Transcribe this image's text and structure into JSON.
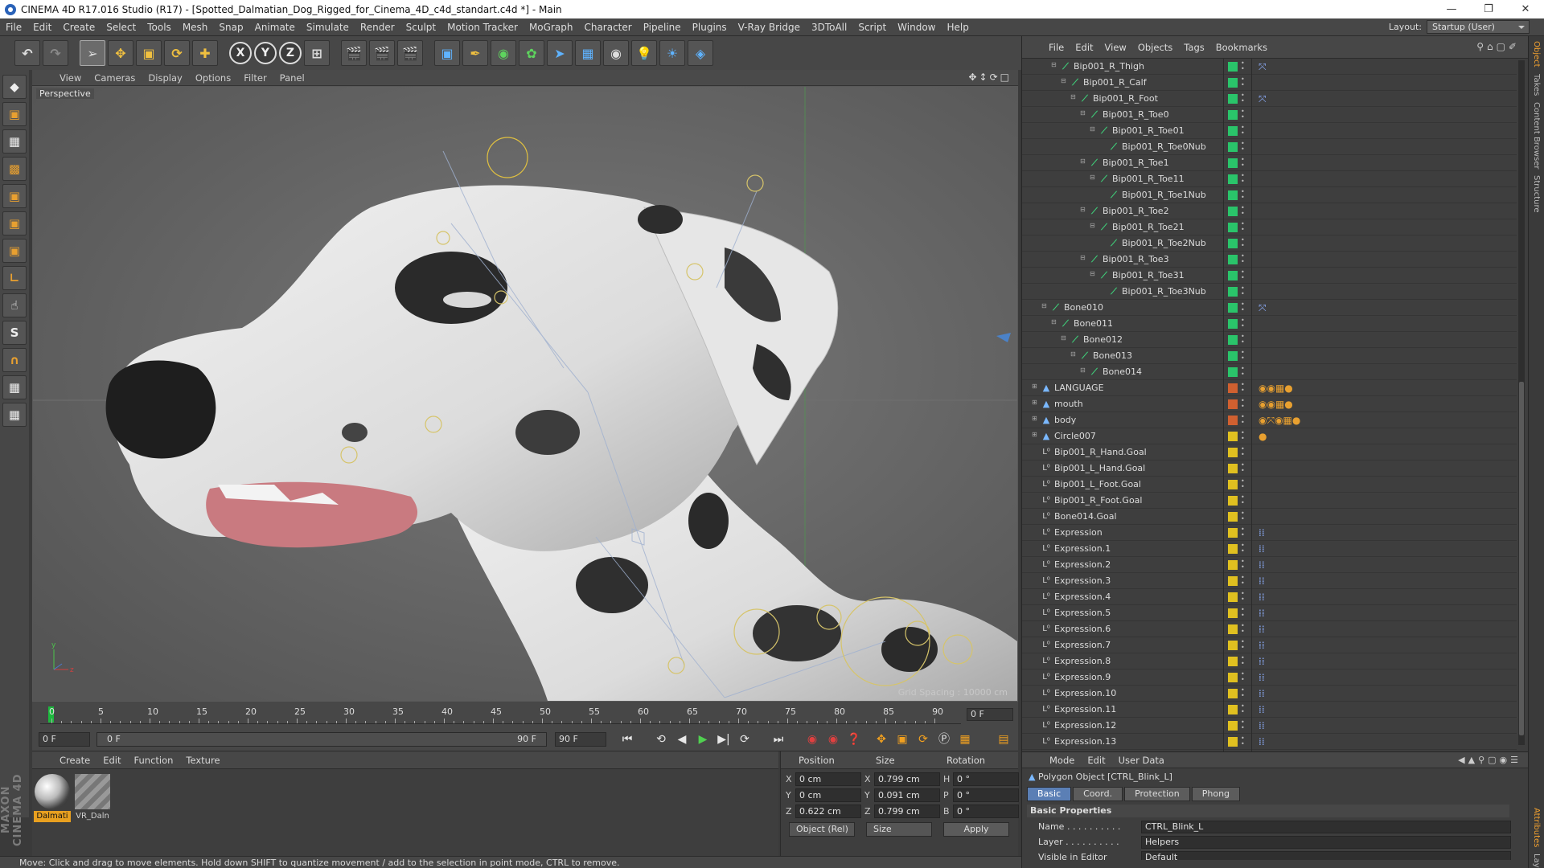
{
  "title": "CINEMA 4D R17.016 Studio (R17) - [Spotted_Dalmatian_Dog_Rigged_for_Cinema_4D_c4d_standart.c4d *] - Main",
  "menu": [
    "File",
    "Edit",
    "Create",
    "Select",
    "Tools",
    "Mesh",
    "Snap",
    "Animate",
    "Simulate",
    "Render",
    "Sculpt",
    "Motion Tracker",
    "MoGraph",
    "Character",
    "Pipeline",
    "Plugins",
    "V-Ray Bridge",
    "3DToAll",
    "Script",
    "Window",
    "Help"
  ],
  "layout": {
    "label": "Layout:",
    "value": "Startup (User)"
  },
  "viewport": {
    "menu": [
      "View",
      "Cameras",
      "Display",
      "Options",
      "Filter",
      "Panel"
    ],
    "camera": "Perspective",
    "grid": "Grid Spacing : 10000 cm"
  },
  "timeline": {
    "ticks": [
      "0",
      "5",
      "10",
      "15",
      "20",
      "25",
      "30",
      "35",
      "40",
      "45",
      "50",
      "55",
      "60",
      "65",
      "70",
      "75",
      "80",
      "85",
      "90"
    ],
    "end": "0 F",
    "start": "0 F",
    "range_start": "0 F",
    "range_end": "90 F",
    "max": "90 F"
  },
  "materials": {
    "menu": [
      "Create",
      "Edit",
      "Function",
      "Texture"
    ],
    "items": [
      "Dalmati",
      "VR_Daln"
    ]
  },
  "coords": {
    "headers": [
      "Position",
      "Size",
      "Rotation"
    ],
    "rows": [
      {
        "axis": "X",
        "pos": "0 cm",
        "s_axis": "X",
        "size": "0.799 cm",
        "r_axis": "H",
        "rot": "0 °"
      },
      {
        "axis": "Y",
        "pos": "0 cm",
        "s_axis": "Y",
        "size": "0.091 cm",
        "r_axis": "P",
        "rot": "0 °"
      },
      {
        "axis": "Z",
        "pos": "0.622 cm",
        "s_axis": "Z",
        "size": "0.799 cm",
        "r_axis": "B",
        "rot": "0 °"
      }
    ],
    "mode": "Object (Rel)",
    "size_mode": "Size",
    "apply": "Apply"
  },
  "status": "Move: Click and drag to move elements. Hold down SHIFT to quantize movement / add to the selection in point mode, CTRL to remove.",
  "objmenu": [
    "File",
    "Edit",
    "View",
    "Objects",
    "Tags",
    "Bookmarks"
  ],
  "objects": [
    {
      "name": "Bip001_R_Thigh",
      "d": 3,
      "t": "bone",
      "c": "#2ac46a",
      "tags": "⤧"
    },
    {
      "name": "Bip001_R_Calf",
      "d": 4,
      "t": "bone",
      "c": "#2ac46a",
      "tags": ""
    },
    {
      "name": "Bip001_R_Foot",
      "d": 5,
      "t": "bone",
      "c": "#2ac46a",
      "tags": "⤧"
    },
    {
      "name": "Bip001_R_Toe0",
      "d": 6,
      "t": "bone",
      "c": "#2ac46a",
      "tags": ""
    },
    {
      "name": "Bip001_R_Toe01",
      "d": 7,
      "t": "bone",
      "c": "#2ac46a",
      "tags": ""
    },
    {
      "name": "Bip001_R_Toe0Nub",
      "d": 8,
      "t": "bone",
      "c": "#2ac46a",
      "tags": ""
    },
    {
      "name": "Bip001_R_Toe1",
      "d": 6,
      "t": "bone",
      "c": "#2ac46a",
      "tags": ""
    },
    {
      "name": "Bip001_R_Toe11",
      "d": 7,
      "t": "bone",
      "c": "#2ac46a",
      "tags": ""
    },
    {
      "name": "Bip001_R_Toe1Nub",
      "d": 8,
      "t": "bone",
      "c": "#2ac46a",
      "tags": ""
    },
    {
      "name": "Bip001_R_Toe2",
      "d": 6,
      "t": "bone",
      "c": "#2ac46a",
      "tags": ""
    },
    {
      "name": "Bip001_R_Toe21",
      "d": 7,
      "t": "bone",
      "c": "#2ac46a",
      "tags": ""
    },
    {
      "name": "Bip001_R_Toe2Nub",
      "d": 8,
      "t": "bone",
      "c": "#2ac46a",
      "tags": ""
    },
    {
      "name": "Bip001_R_Toe3",
      "d": 6,
      "t": "bone",
      "c": "#2ac46a",
      "tags": ""
    },
    {
      "name": "Bip001_R_Toe31",
      "d": 7,
      "t": "bone",
      "c": "#2ac46a",
      "tags": ""
    },
    {
      "name": "Bip001_R_Toe3Nub",
      "d": 8,
      "t": "bone",
      "c": "#2ac46a",
      "tags": ""
    },
    {
      "name": "Bone010",
      "d": 2,
      "t": "bone",
      "c": "#2ac46a",
      "tags": "⤧"
    },
    {
      "name": "Bone011",
      "d": 3,
      "t": "bone",
      "c": "#2ac46a",
      "tags": ""
    },
    {
      "name": "Bone012",
      "d": 4,
      "t": "bone",
      "c": "#2ac46a",
      "tags": ""
    },
    {
      "name": "Bone013",
      "d": 5,
      "t": "bone",
      "c": "#2ac46a",
      "tags": ""
    },
    {
      "name": "Bone014",
      "d": 6,
      "t": "bone",
      "c": "#2ac46a",
      "tags": ""
    },
    {
      "name": "LANGUAGE",
      "d": 1,
      "t": "poly",
      "c": "#d06030",
      "tags": "◉◉▦●"
    },
    {
      "name": "mouth",
      "d": 1,
      "t": "poly",
      "c": "#d06030",
      "tags": "◉◉▦●"
    },
    {
      "name": "body",
      "d": 1,
      "t": "poly",
      "c": "#d06030",
      "tags": "◉⤧◉▦●"
    },
    {
      "name": "Circle007",
      "d": 1,
      "t": "poly",
      "c": "#e0c020",
      "tags": "●"
    },
    {
      "name": "Bip001_R_Hand.Goal",
      "d": 1,
      "t": "null",
      "c": "#e0c020",
      "tags": ""
    },
    {
      "name": "Bip001_L_Hand.Goal",
      "d": 1,
      "t": "null",
      "c": "#e0c020",
      "tags": ""
    },
    {
      "name": "Bip001_L_Foot.Goal",
      "d": 1,
      "t": "null",
      "c": "#e0c020",
      "tags": ""
    },
    {
      "name": "Bip001_R_Foot.Goal",
      "d": 1,
      "t": "null",
      "c": "#e0c020",
      "tags": ""
    },
    {
      "name": "Bone014.Goal",
      "d": 1,
      "t": "null",
      "c": "#e0c020",
      "tags": ""
    },
    {
      "name": "Expression",
      "d": 1,
      "t": "null",
      "c": "#e0c020",
      "tags": "⁞⁞"
    },
    {
      "name": "Expression.1",
      "d": 1,
      "t": "null",
      "c": "#e0c020",
      "tags": "⁞⁞"
    },
    {
      "name": "Expression.2",
      "d": 1,
      "t": "null",
      "c": "#e0c020",
      "tags": "⁞⁞"
    },
    {
      "name": "Expression.3",
      "d": 1,
      "t": "null",
      "c": "#e0c020",
      "tags": "⁞⁞"
    },
    {
      "name": "Expression.4",
      "d": 1,
      "t": "null",
      "c": "#e0c020",
      "tags": "⁞⁞"
    },
    {
      "name": "Expression.5",
      "d": 1,
      "t": "null",
      "c": "#e0c020",
      "tags": "⁞⁞"
    },
    {
      "name": "Expression.6",
      "d": 1,
      "t": "null",
      "c": "#e0c020",
      "tags": "⁞⁞"
    },
    {
      "name": "Expression.7",
      "d": 1,
      "t": "null",
      "c": "#e0c020",
      "tags": "⁞⁞"
    },
    {
      "name": "Expression.8",
      "d": 1,
      "t": "null",
      "c": "#e0c020",
      "tags": "⁞⁞"
    },
    {
      "name": "Expression.9",
      "d": 1,
      "t": "null",
      "c": "#e0c020",
      "tags": "⁞⁞"
    },
    {
      "name": "Expression.10",
      "d": 1,
      "t": "null",
      "c": "#e0c020",
      "tags": "⁞⁞"
    },
    {
      "name": "Expression.11",
      "d": 1,
      "t": "null",
      "c": "#e0c020",
      "tags": "⁞⁞"
    },
    {
      "name": "Expression.12",
      "d": 1,
      "t": "null",
      "c": "#e0c020",
      "tags": "⁞⁞"
    },
    {
      "name": "Expression.13",
      "d": 1,
      "t": "null",
      "c": "#e0c020",
      "tags": "⁞⁞"
    }
  ],
  "attr": {
    "menu": [
      "Mode",
      "Edit",
      "User Data"
    ],
    "object": "Polygon Object [CTRL_Blink_L]",
    "tabs": [
      "Basic",
      "Coord.",
      "Protection",
      "Phong"
    ],
    "section": "Basic Properties",
    "name_label": "Name . . . . . . . . . .",
    "name": "CTRL_Blink_L",
    "layer_label": "Layer . . . . . . . . . .",
    "layer": "Helpers",
    "vis_label": "Visible in Editor",
    "vis": "Default"
  },
  "rightstrip": [
    "Object",
    "Takes",
    "Content Browser",
    "Structure",
    "Attributes",
    "Layers"
  ]
}
